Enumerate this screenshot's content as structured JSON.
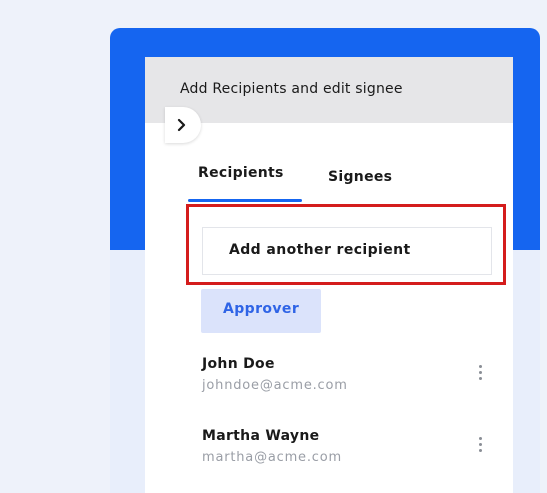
{
  "drawer": {
    "title": "Add Recipients and edit signee"
  },
  "tabs": [
    {
      "label": "Recipients",
      "active": true
    },
    {
      "label": "Signees",
      "active": false
    }
  ],
  "add_recipient": {
    "label": "Add another recipient"
  },
  "role_chip": {
    "label": "Approver"
  },
  "recipients": [
    {
      "name": "John Doe",
      "email": "johndoe@acme.com"
    },
    {
      "name": "Martha Wayne",
      "email": "martha@acme.com"
    }
  ],
  "icons": {
    "collapse_toggle": "chevron-right-icon",
    "more_menu": "kebab-menu-icon"
  },
  "colors": {
    "accent": "#1565f0",
    "highlight": "#d41c1c",
    "chip_bg": "#dbe3fb",
    "chip_text": "#2f64e6"
  }
}
